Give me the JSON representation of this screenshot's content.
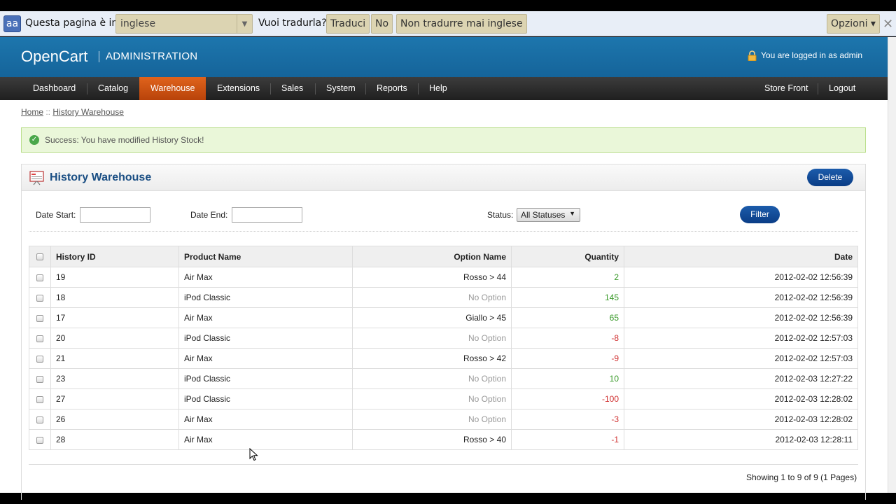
{
  "translate_bar": {
    "icon": "aa",
    "label": "Questa pagina è in",
    "language": "inglese",
    "question": "Vuoi tradurla?",
    "translate_button": "Traduci",
    "no_button": "No",
    "never_button": "Non tradurre mai inglese",
    "options_button": "Opzioni ▾",
    "close": "✕"
  },
  "header": {
    "logo": "OpenCart",
    "subtitle": "ADMINISTRATION",
    "logged_in": "You are logged in as admin"
  },
  "menu": {
    "items": [
      "Dashboard",
      "Catalog",
      "Warehouse",
      "Extensions",
      "Sales",
      "System",
      "Reports",
      "Help"
    ],
    "active": "Warehouse",
    "right": [
      "Store Front",
      "Logout"
    ]
  },
  "breadcrumb": {
    "home": "Home",
    "sep": " :: ",
    "current": "History Warehouse"
  },
  "success_message": "Success: You have modified History Stock!",
  "box": {
    "title": "History Warehouse",
    "delete_button": "Delete",
    "filter_button": "Filter",
    "date_start_label": "Date Start:",
    "date_end_label": "Date End:",
    "date_start_value": "",
    "date_end_value": "",
    "status_label": "Status:",
    "status_value": "All Statuses"
  },
  "table": {
    "headers": [
      "History ID",
      "Product Name",
      "Option Name",
      "Quantity",
      "Date"
    ],
    "rows": [
      {
        "id": "19",
        "product": "Air Max",
        "option": "Rosso > 44",
        "qty": "2",
        "date": "2012-02-02 12:56:39"
      },
      {
        "id": "18",
        "product": "iPod Classic",
        "option": "No Option",
        "qty": "145",
        "date": "2012-02-02 12:56:39"
      },
      {
        "id": "17",
        "product": "Air Max",
        "option": "Giallo > 45",
        "qty": "65",
        "date": "2012-02-02 12:56:39"
      },
      {
        "id": "20",
        "product": "iPod Classic",
        "option": "No Option",
        "qty": "-8",
        "date": "2012-02-02 12:57:03"
      },
      {
        "id": "21",
        "product": "Air Max",
        "option": "Rosso > 42",
        "qty": "-9",
        "date": "2012-02-02 12:57:03"
      },
      {
        "id": "23",
        "product": "iPod Classic",
        "option": "No Option",
        "qty": "10",
        "date": "2012-02-03 12:27:22"
      },
      {
        "id": "27",
        "product": "iPod Classic",
        "option": "No Option",
        "qty": "-100",
        "date": "2012-02-03 12:28:02"
      },
      {
        "id": "26",
        "product": "Air Max",
        "option": "No Option",
        "qty": "-3",
        "date": "2012-02-03 12:28:02"
      },
      {
        "id": "28",
        "product": "Air Max",
        "option": "Rosso > 40",
        "qty": "-1",
        "date": "2012-02-03 12:28:11"
      }
    ]
  },
  "pagination": "Showing 1 to 9 of 9 (1 Pages)",
  "colors": {
    "positive": "#3a9a2a",
    "negative": "#d03030",
    "muted": "#999999",
    "accent": "#e0631c",
    "header": "#1d76ad"
  }
}
